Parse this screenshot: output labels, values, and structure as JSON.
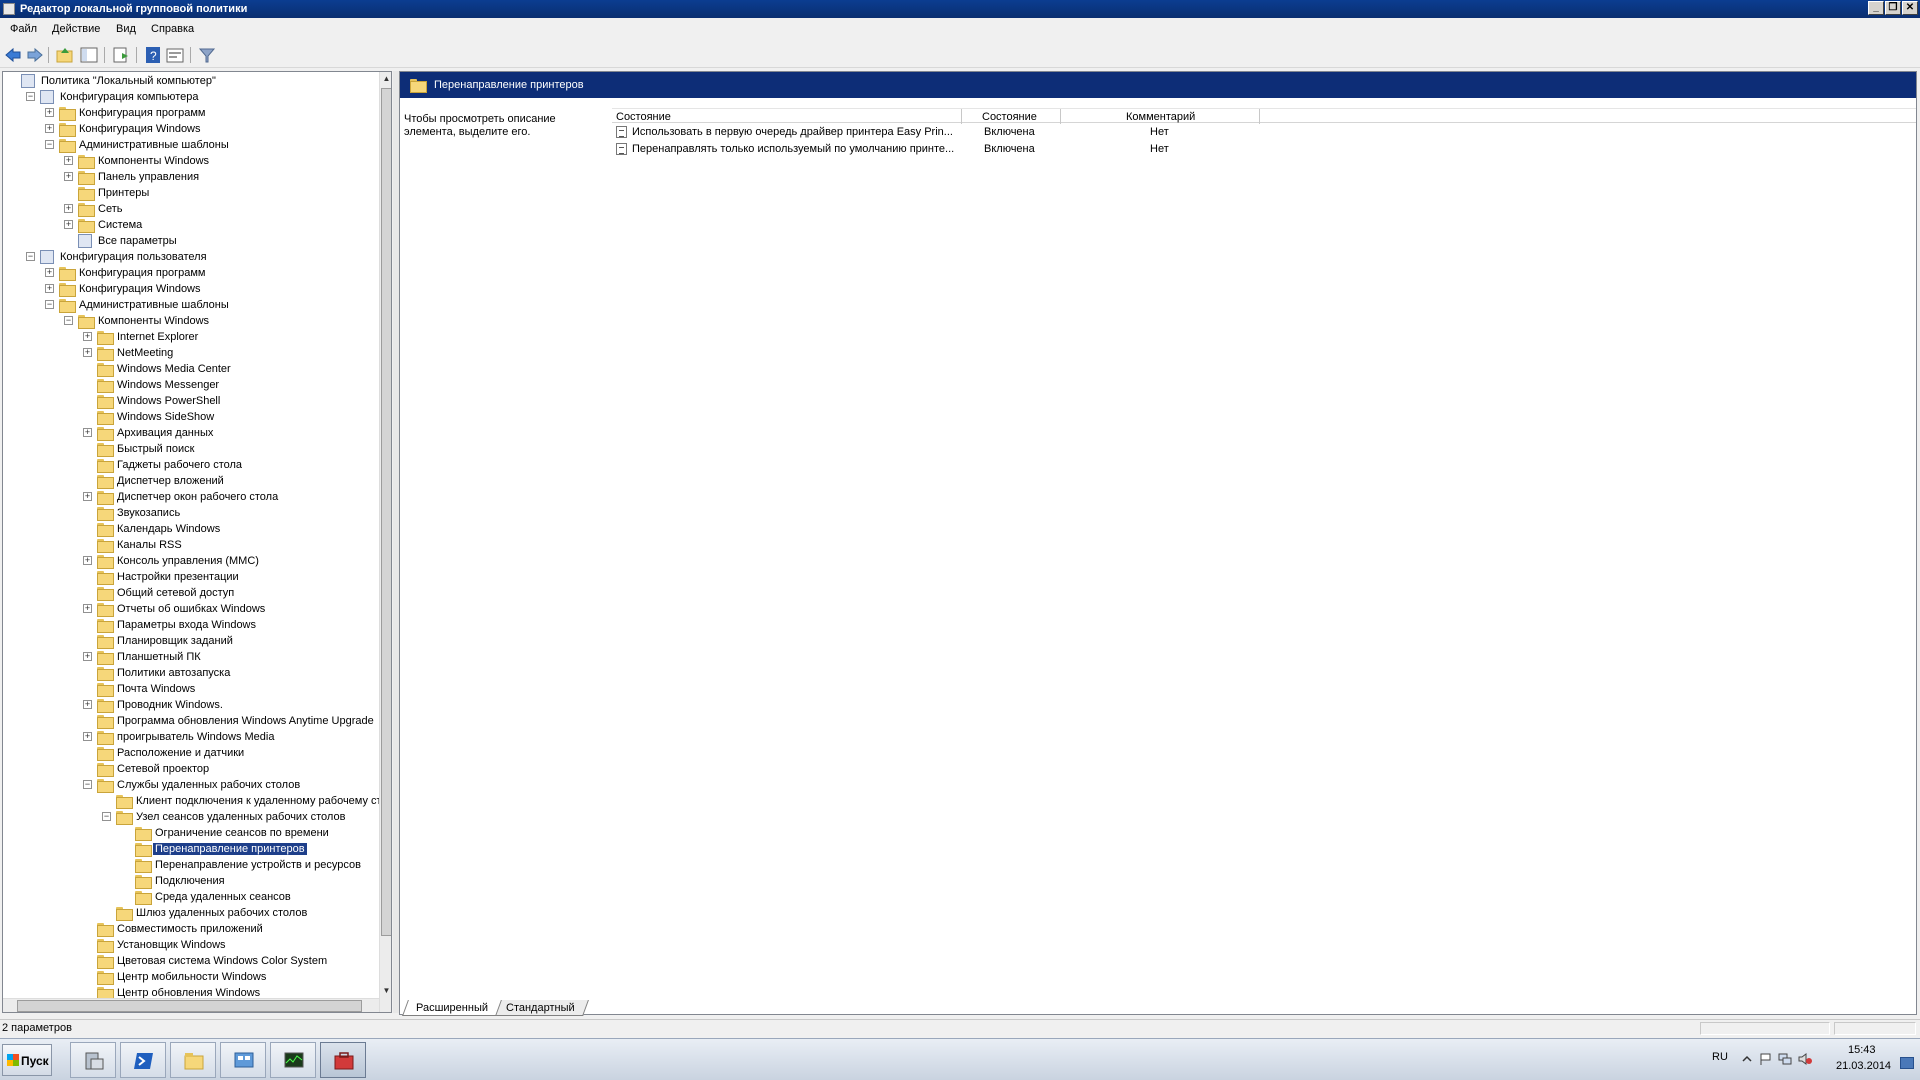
{
  "window": {
    "title": "Редактор локальной групповой политики",
    "minimize": "_",
    "restore": "❐",
    "close": "✕"
  },
  "menu": [
    "Файл",
    "Действие",
    "Вид",
    "Справка"
  ],
  "toolbar_icons": [
    "back-icon",
    "forward-icon",
    "up-folder-icon",
    "show-hide-tree-icon",
    "export-list-icon",
    "help-icon",
    "properties-icon",
    "filter-icon"
  ],
  "tree": [
    {
      "label": "Политика \"Локальный компьютер\"",
      "level": 0,
      "exp": "",
      "icon": "doc"
    },
    {
      "label": "Конфигурация компьютера",
      "level": 1,
      "exp": "−",
      "icon": "computer"
    },
    {
      "label": "Конфигурация программ",
      "level": 2,
      "exp": "+",
      "icon": "folder"
    },
    {
      "label": "Конфигурация Windows",
      "level": 2,
      "exp": "+",
      "icon": "folder"
    },
    {
      "label": "Административные шаблоны",
      "level": 2,
      "exp": "−",
      "icon": "folder"
    },
    {
      "label": "Компоненты Windows",
      "level": 3,
      "exp": "+",
      "icon": "folder"
    },
    {
      "label": "Панель управления",
      "level": 3,
      "exp": "+",
      "icon": "folder"
    },
    {
      "label": "Принтеры",
      "level": 3,
      "exp": "",
      "icon": "folder"
    },
    {
      "label": "Сеть",
      "level": 3,
      "exp": "+",
      "icon": "folder"
    },
    {
      "label": "Система",
      "level": 3,
      "exp": "+",
      "icon": "folder"
    },
    {
      "label": "Все параметры",
      "level": 3,
      "exp": "",
      "icon": "doc"
    },
    {
      "label": "Конфигурация пользователя",
      "level": 1,
      "exp": "−",
      "icon": "user"
    },
    {
      "label": "Конфигурация программ",
      "level": 2,
      "exp": "+",
      "icon": "folder"
    },
    {
      "label": "Конфигурация Windows",
      "level": 2,
      "exp": "+",
      "icon": "folder"
    },
    {
      "label": "Административные шаблоны",
      "level": 2,
      "exp": "−",
      "icon": "folder"
    },
    {
      "label": "Компоненты Windows",
      "level": 3,
      "exp": "−",
      "icon": "folder"
    },
    {
      "label": "Internet Explorer",
      "level": 4,
      "exp": "+",
      "icon": "folder"
    },
    {
      "label": "NetMeeting",
      "level": 4,
      "exp": "+",
      "icon": "folder"
    },
    {
      "label": "Windows Media Center",
      "level": 4,
      "exp": "",
      "icon": "folder"
    },
    {
      "label": "Windows Messenger",
      "level": 4,
      "exp": "",
      "icon": "folder"
    },
    {
      "label": "Windows PowerShell",
      "level": 4,
      "exp": "",
      "icon": "folder"
    },
    {
      "label": "Windows SideShow",
      "level": 4,
      "exp": "",
      "icon": "folder"
    },
    {
      "label": "Архивация данных",
      "level": 4,
      "exp": "+",
      "icon": "folder"
    },
    {
      "label": "Быстрый поиск",
      "level": 4,
      "exp": "",
      "icon": "folder"
    },
    {
      "label": "Гаджеты рабочего стола",
      "level": 4,
      "exp": "",
      "icon": "folder"
    },
    {
      "label": "Диспетчер вложений",
      "level": 4,
      "exp": "",
      "icon": "folder"
    },
    {
      "label": "Диспетчер окон рабочего стола",
      "level": 4,
      "exp": "+",
      "icon": "folder"
    },
    {
      "label": "Звукозапись",
      "level": 4,
      "exp": "",
      "icon": "folder"
    },
    {
      "label": "Календарь Windows",
      "level": 4,
      "exp": "",
      "icon": "folder"
    },
    {
      "label": "Каналы RSS",
      "level": 4,
      "exp": "",
      "icon": "folder"
    },
    {
      "label": "Консоль управления (MMC)",
      "level": 4,
      "exp": "+",
      "icon": "folder"
    },
    {
      "label": "Настройки презентации",
      "level": 4,
      "exp": "",
      "icon": "folder"
    },
    {
      "label": "Общий сетевой доступ",
      "level": 4,
      "exp": "",
      "icon": "folder"
    },
    {
      "label": "Отчеты об ошибках Windows",
      "level": 4,
      "exp": "+",
      "icon": "folder"
    },
    {
      "label": "Параметры входа Windows",
      "level": 4,
      "exp": "",
      "icon": "folder"
    },
    {
      "label": "Планировщик заданий",
      "level": 4,
      "exp": "",
      "icon": "folder"
    },
    {
      "label": "Планшетный ПК",
      "level": 4,
      "exp": "+",
      "icon": "folder"
    },
    {
      "label": "Политики автозапуска",
      "level": 4,
      "exp": "",
      "icon": "folder"
    },
    {
      "label": "Почта Windows",
      "level": 4,
      "exp": "",
      "icon": "folder"
    },
    {
      "label": "Проводник Windows.",
      "level": 4,
      "exp": "+",
      "icon": "folder"
    },
    {
      "label": "Программа обновления Windows Anytime Upgrade",
      "level": 4,
      "exp": "",
      "icon": "folder"
    },
    {
      "label": "проигрыватель Windows Media",
      "level": 4,
      "exp": "+",
      "icon": "folder"
    },
    {
      "label": "Расположение и датчики",
      "level": 4,
      "exp": "",
      "icon": "folder"
    },
    {
      "label": "Сетевой проектор",
      "level": 4,
      "exp": "",
      "icon": "folder"
    },
    {
      "label": "Службы удаленных рабочих столов",
      "level": 4,
      "exp": "−",
      "icon": "folder"
    },
    {
      "label": "Клиент подключения к удаленному рабочему сто.",
      "level": 5,
      "exp": "",
      "icon": "folder"
    },
    {
      "label": "Узел сеансов удаленных рабочих столов",
      "level": 5,
      "exp": "−",
      "icon": "folder"
    },
    {
      "label": "Ограничение сеансов по времени",
      "level": 6,
      "exp": "",
      "icon": "folder"
    },
    {
      "label": "Перенаправление принтеров",
      "level": 6,
      "exp": "",
      "icon": "folder",
      "selected": true
    },
    {
      "label": "Перенаправление устройств и ресурсов",
      "level": 6,
      "exp": "",
      "icon": "folder"
    },
    {
      "label": "Подключения",
      "level": 6,
      "exp": "",
      "icon": "folder"
    },
    {
      "label": "Среда удаленных сеансов",
      "level": 6,
      "exp": "",
      "icon": "folder"
    },
    {
      "label": "Шлюз удаленных рабочих столов",
      "level": 5,
      "exp": "",
      "icon": "folder"
    },
    {
      "label": "Совместимость приложений",
      "level": 4,
      "exp": "",
      "icon": "folder"
    },
    {
      "label": "Установщик Windows",
      "level": 4,
      "exp": "",
      "icon": "folder"
    },
    {
      "label": "Цветовая система Windows Color System",
      "level": 4,
      "exp": "",
      "icon": "folder"
    },
    {
      "label": "Центр мобильности Windows",
      "level": 4,
      "exp": "",
      "icon": "folder"
    },
    {
      "label": "Центр обновления Windows",
      "level": 4,
      "exp": "",
      "icon": "folder"
    }
  ],
  "right": {
    "title": "Перенаправление принтеров",
    "description": "Чтобы просмотреть описание элемента, выделите его.",
    "columns": [
      "Состояние",
      "Состояние",
      "Комментарий"
    ],
    "rows": [
      {
        "name": "Использовать в первую очередь драйвер принтера Easy Prin...",
        "state": "Включена",
        "comment": "Нет"
      },
      {
        "name": "Перенаправлять только используемый по умолчанию принте...",
        "state": "Включена",
        "comment": "Нет"
      }
    ]
  },
  "tabs": [
    "Расширенный",
    "Стандартный"
  ],
  "status": "2 параметров",
  "taskbar": {
    "start": "Пуск",
    "apps": [
      "server-manager-icon",
      "powershell-icon",
      "explorer-icon",
      "control-panel-icon",
      "performance-monitor-icon",
      "toolbox-icon"
    ],
    "lang": "RU",
    "time": "15:43",
    "date": "21.03.2014"
  }
}
